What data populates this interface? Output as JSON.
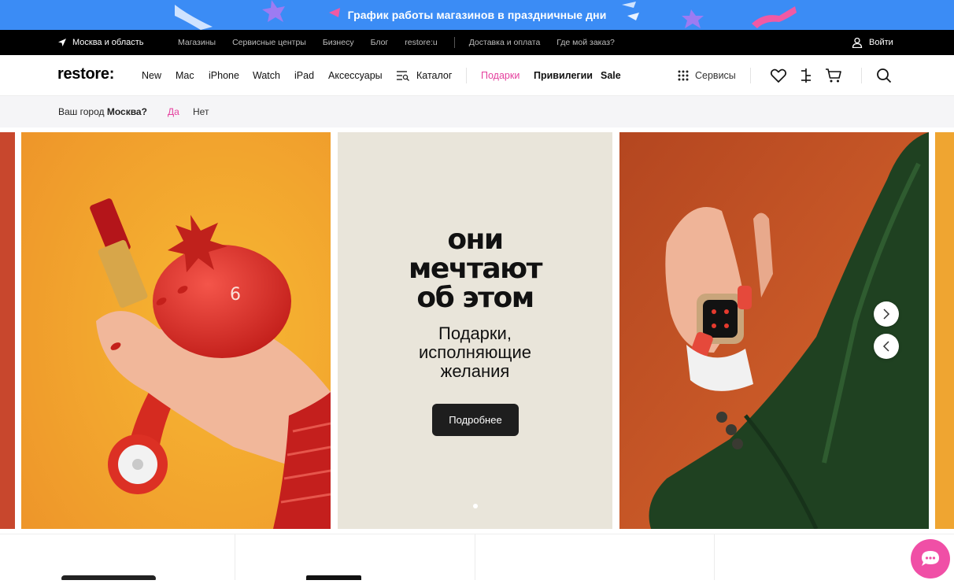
{
  "promo": {
    "text": "График работы магазинов в праздничные дни"
  },
  "topbar": {
    "location": "Москва и область",
    "links": [
      "Магазины",
      "Сервисные центры",
      "Бизнесу",
      "Блог",
      "restore:u"
    ],
    "links2": [
      "Доставка и оплата",
      "Где мой заказ?"
    ],
    "login": "Войти"
  },
  "nav": {
    "logo": "restore:",
    "items": [
      "New",
      "Mac",
      "iPhone",
      "Watch",
      "iPad",
      "Аксессуары"
    ],
    "catalog": "Каталог",
    "gifts": "Подарки",
    "privileges": "Привилегии",
    "sale": "Sale",
    "services": "Сервисы"
  },
  "citybar": {
    "question": "Ваш город",
    "city": "Москва?",
    "yes": "Да",
    "no": "Нет"
  },
  "hero": {
    "headline": [
      "они",
      "мечтают",
      "об этом"
    ],
    "subline": [
      "Подарки,",
      "исполняющие",
      "желания"
    ],
    "cta": "Подробнее",
    "badge_digit": "6"
  },
  "colors": {
    "promo_bg": "#3b8cf5",
    "accent_pink": "#e5409e",
    "chat_bg": "#f04fa6",
    "cta_bg": "#1e1e1e",
    "topbar_bg": "#000000"
  }
}
